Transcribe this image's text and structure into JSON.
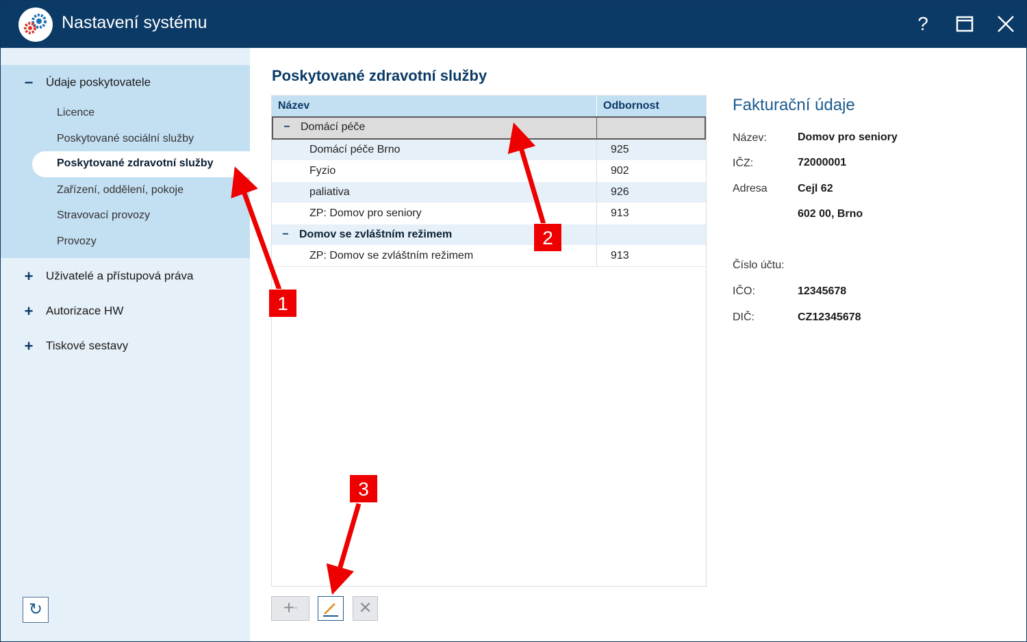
{
  "window": {
    "title": "Nastavení systému"
  },
  "titlebar": {
    "help": "?",
    "maximize": "☐",
    "close": "✕"
  },
  "sidebar": {
    "group1": {
      "toggle": "−",
      "label": "Údaje poskytovatele"
    },
    "sub_items": [
      "Licence",
      "Poskytované sociální služby",
      "Poskytované zdravotní služby",
      "Zařízení, oddělení, pokoje",
      "Stravovací provozy",
      "Provozy"
    ],
    "groups": [
      {
        "toggle": "+",
        "label": "Uživatelé a přístupová práva"
      },
      {
        "toggle": "+",
        "label": "Autorizace HW"
      },
      {
        "toggle": "+",
        "label": "Tiskové sestavy"
      }
    ],
    "refresh": "↻"
  },
  "main": {
    "title": "Poskytované zdravotní služby",
    "grid": {
      "columns": [
        "Název",
        "Odbornost"
      ],
      "rows": [
        {
          "type": "group",
          "toggle": "−",
          "name": "Domácí péče",
          "code": ""
        },
        {
          "type": "item",
          "name": "Domácí péče Brno",
          "code": "925"
        },
        {
          "type": "item",
          "name": "Fyzio",
          "code": "902"
        },
        {
          "type": "item",
          "name": "paliativa",
          "code": "926"
        },
        {
          "type": "item",
          "name": "ZP: Domov pro seniory",
          "code": "913"
        },
        {
          "type": "group",
          "toggle": "−",
          "name": "Domov se zvláštním režimem",
          "code": ""
        },
        {
          "type": "item",
          "name": "ZP: Domov se zvláštním režimem",
          "code": "913"
        }
      ]
    },
    "buttons": {
      "add": "+",
      "add_caret": "ˆ",
      "delete": "✕"
    }
  },
  "billing": {
    "title": "Fakturační údaje",
    "fields": [
      {
        "label": "Název:",
        "value": "Domov pro seniory"
      },
      {
        "label": "IČZ:",
        "value": "72000001"
      },
      {
        "label": "Adresa",
        "value": "Cejl 62"
      },
      {
        "label": "",
        "value": "602 00, Brno"
      },
      {
        "label": "Číslo účtu:",
        "value": ""
      },
      {
        "label": "IČO:",
        "value": "12345678"
      },
      {
        "label": "DIČ:",
        "value": "CZ12345678"
      }
    ]
  },
  "annotations": {
    "badge1": "1",
    "badge2": "2",
    "badge3": "3",
    "color": "#ee0000"
  }
}
